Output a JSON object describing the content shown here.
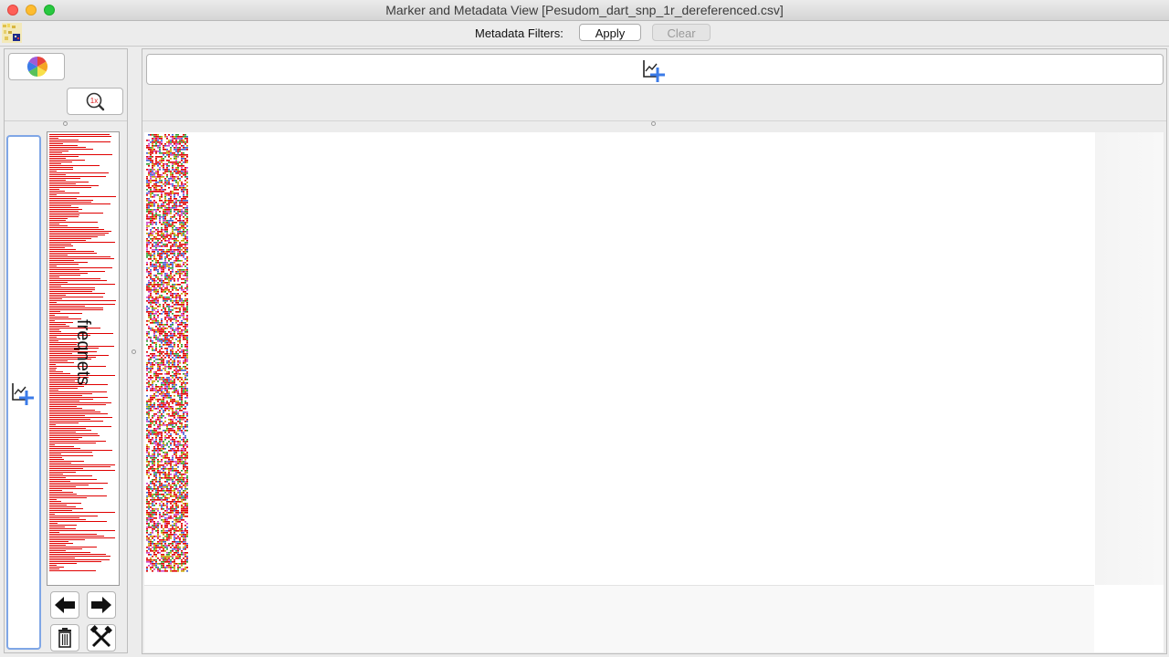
{
  "window": {
    "title": "Marker and Metadata View [Pesudom_dart_snp_1r_dereferenced.csv]"
  },
  "filter_bar": {
    "label": "Metadata Filters:",
    "apply_label": "Apply",
    "clear_label": "Clear"
  },
  "left_panel": {
    "summary_label": "freqnets",
    "zoom_badge": "1x"
  },
  "colors": {
    "accent_blue": "#3b7be8",
    "frequency_bar_red": "#e00000",
    "traffic_close": "#fe5f57",
    "traffic_min": "#febc2e",
    "traffic_max": "#28c840"
  },
  "icons": {
    "color_palette": "color-wheel-icon",
    "zoom": "zoom-1x-icon",
    "add_chart": "add-chart-icon",
    "prev": "arrow-left-icon",
    "next": "arrow-right-icon",
    "delete": "trash-icon",
    "tools": "crossed-tools-icon"
  }
}
